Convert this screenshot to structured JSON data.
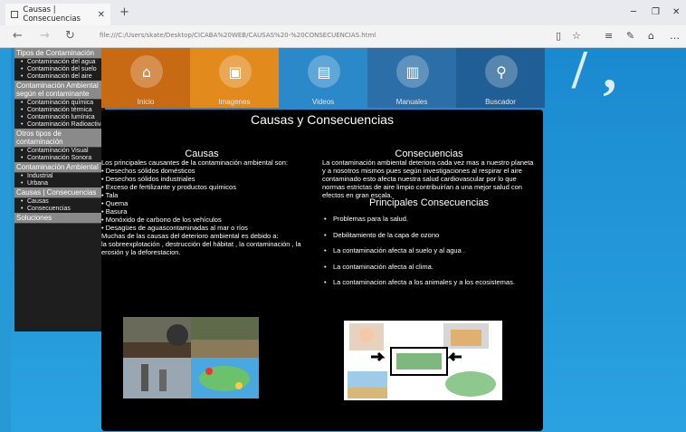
{
  "browser": {
    "tab_title": "Causas | Consecuencias",
    "url": "file:///C:/Users/skate/Desktop/CICABA%20WEB/CAUSAS%20-%20CONSECUENCIAS.html"
  },
  "sidebar": {
    "sections": [
      {
        "title": "Tipos de Contaminación",
        "items": [
          "Contaminación del agua",
          "Contaminación del suelo",
          "Contaminación del aire"
        ]
      },
      {
        "title": "Contaminación Ambiental según el contaminante",
        "items": [
          "Contaminación química",
          "Contaminación térmica",
          "Contaminación lumínica",
          "Contaminación Radioactiva"
        ]
      },
      {
        "title": "Otros tipos de contaminación",
        "items": [
          "Contaminación Visual",
          "Contaminación Sonora"
        ]
      },
      {
        "title": "Contaminación Ambiental",
        "items": [
          "Industrial",
          "Urbana"
        ]
      },
      {
        "title": "Causas | Consecuencias",
        "items": [
          "Causas",
          "Consecuencias"
        ]
      },
      {
        "title": "Soluciones",
        "items": []
      }
    ]
  },
  "menu": {
    "items": [
      {
        "label": "Inicio",
        "icon": "home-icon",
        "color": "#c86a14"
      },
      {
        "label": "Imagenes",
        "icon": "image-icon",
        "color": "#e38a1d"
      },
      {
        "label": "Videos",
        "icon": "film-icon",
        "color": "#2b88c9"
      },
      {
        "label": "Manuales",
        "icon": "chart-icon",
        "color": "#2b6ea8"
      },
      {
        "label": "Buscador",
        "icon": "search-icon",
        "color": "#1f5f95"
      }
    ]
  },
  "main": {
    "title": "Causas y Consecuencias",
    "causas": {
      "heading": "Causas",
      "intro": "Los principales causantes de la contaminación ambiental son:",
      "items": [
        "Desechos sólidos domésticos",
        "Desechos sólidos industriales",
        "Exceso de fertilizante y productos químicos",
        "Tala",
        "Quema",
        "Basura",
        "Monóxido de carbono de los vehículos",
        "Desagües de aguascontaminadas al mar o ríos"
      ],
      "outro1": "Muchas de las causas del deterioro ambiental es debido a:",
      "outro2": "la sobreexplotación , destrucción del hábitat , la contaminación , la erosión y la deforestacion."
    },
    "consecuencias": {
      "heading": "Consecuencias",
      "text": "La contaminación ambiental deteriora cada vez mas a nuestro planeta y a nosotros mismos pues según investigaciones al respirar el aire contaminado esto afecta nuestra salud cardiovascular por lo que normas estrictas de aire limpio contribuirían a una mejor salud con efectos en gran escala.",
      "subheading": "Principales Consecuencias",
      "items": [
        "Problemas para la salud.",
        "Debilitamiento de la capa de ozono",
        "La contaminación afecta al suelo y al agua .",
        "La contaminación afecta al clima.",
        "La contaminacion afecta a los animales y a los ecosistemas."
      ]
    }
  }
}
